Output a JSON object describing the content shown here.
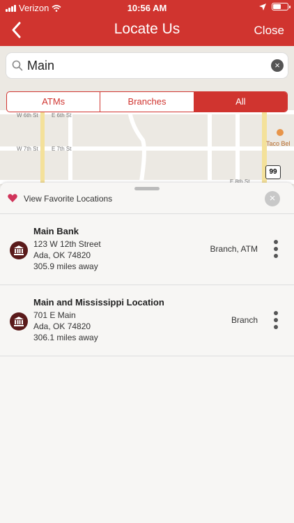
{
  "status": {
    "carrier": "Verizon",
    "time": "10:56 AM"
  },
  "nav": {
    "title": "Locate Us",
    "close_label": "Close"
  },
  "search": {
    "value": "Main"
  },
  "filters": [
    {
      "label": "ATMs",
      "active": false
    },
    {
      "label": "Branches",
      "active": false
    },
    {
      "label": "All",
      "active": true
    }
  ],
  "map": {
    "streets": [
      "W 6th St",
      "E 6th St",
      "W 7th St",
      "E 7th St",
      "E 8th St"
    ],
    "poi": "Taco Bel",
    "route_shield": "99"
  },
  "favorites": {
    "label": "View Favorite Locations"
  },
  "locations": [
    {
      "name": "Main Bank",
      "address1": "123 W 12th Street",
      "address2": "Ada, OK 74820",
      "distance": "305.9 miles away",
      "type": "Branch, ATM"
    },
    {
      "name": "Main and Mississippi Location",
      "address1": "701 E Main",
      "address2": "Ada, OK 74820",
      "distance": "306.1 miles away",
      "type": "Branch"
    }
  ],
  "colors": {
    "brand": "#d0342f",
    "icon_bg": "#5a1a1a"
  },
  "icons": [
    "chevron-left-icon",
    "search-icon",
    "heart-icon",
    "close-icon",
    "bank-icon",
    "more-vertical-icon"
  ]
}
